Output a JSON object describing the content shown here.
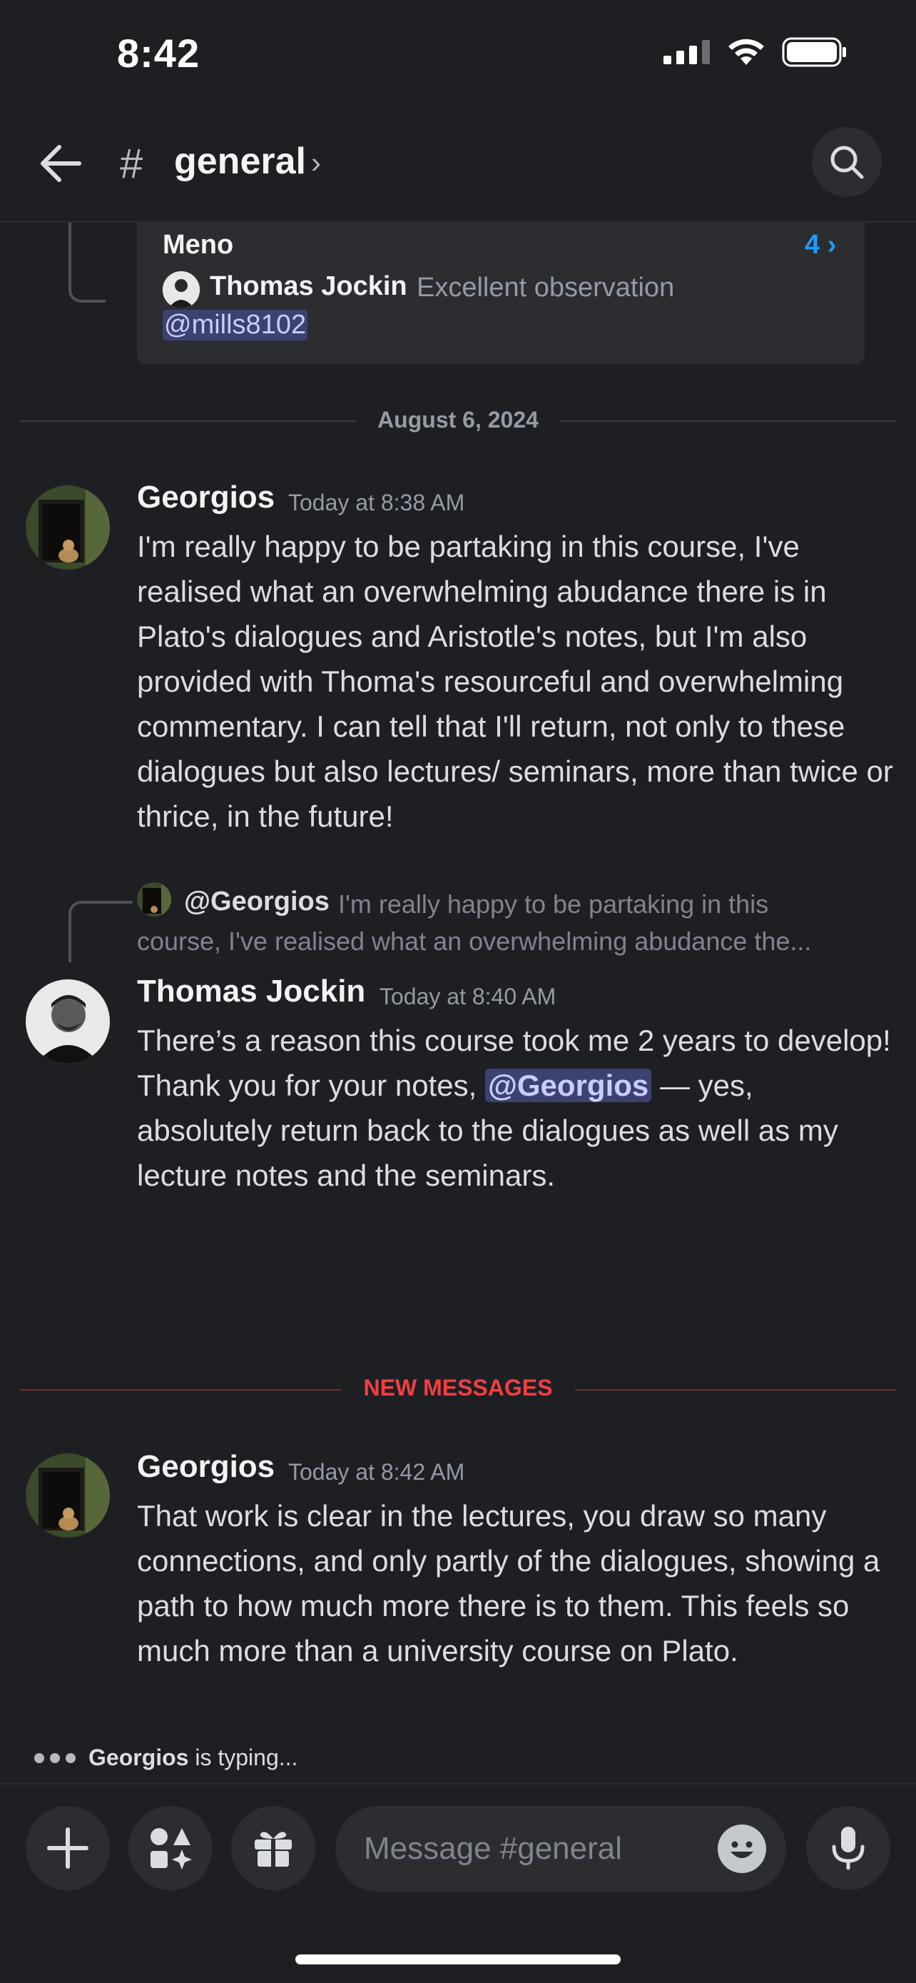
{
  "status_bar": {
    "time": "8:42"
  },
  "header": {
    "hash": "#",
    "channel": "general",
    "chevron": "›"
  },
  "thread": {
    "name": "Meno",
    "count": "4 ›",
    "author": "Thomas Jockin",
    "preview": "Excellent observation",
    "mention": "@mills8102"
  },
  "date_divider": "August 6, 2024",
  "messages": [
    {
      "author": "Georgios",
      "time": "Today at 8:38 AM",
      "text": "I'm really happy to be partaking in this course, I've realised what an overwhelming abudance there is in Plato's dialogues and Aristotle's notes, but I'm also provided with Thoma's resourceful and overwhelming commentary. I can tell that I'll return, not only to these dialogues but also lectures/ seminars, more than twice or thrice, in the future!"
    },
    {
      "reply_to": {
        "author": "@Georgios",
        "text_line1": "I'm really happy to be partaking in this",
        "text_line2": "course, I've realised what an overwhelming abudance the..."
      },
      "author": "Thomas Jockin",
      "time": "Today at 8:40 AM",
      "text_before": "There’s a reason this course took me 2 years to develop! Thank you for your notes,",
      "mention": "@Georgios",
      "text_after": "— yes, absolutely return back to the dialogues as well as my lecture notes and the seminars."
    },
    {
      "author": "Georgios",
      "time": "Today at 8:42 AM",
      "text": "That work is clear in the lectures, you draw so many connections, and only partly of the dialogues, showing a path to how much more there is to them. This feels so much more than a university course on Plato."
    }
  ],
  "new_messages_label": "NEW MESSAGES",
  "typing": {
    "user": "Georgios",
    "suffix": "is typing..."
  },
  "composer": {
    "placeholder": "Message #general",
    "value": ""
  },
  "colors": {
    "background": "#1e1f23",
    "accent_blue": "#1e9bff",
    "new_messages_red": "#f23f43",
    "mention_bg": "#3c4270"
  }
}
